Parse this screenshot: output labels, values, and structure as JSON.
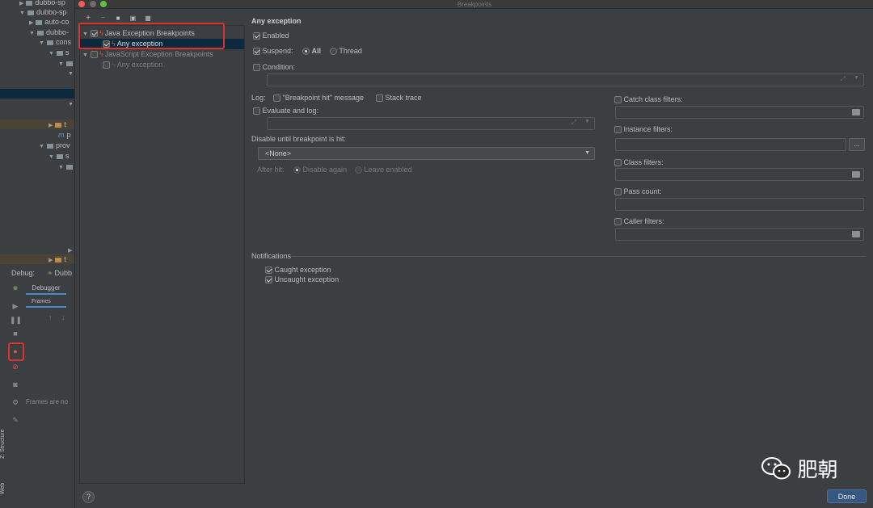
{
  "ide": {
    "tree": [
      {
        "label": "dubbo-sp"
      },
      {
        "label": "dubbo-sp"
      },
      {
        "label": "auto-co"
      },
      {
        "label": "dubbo-"
      },
      {
        "label": "cons"
      },
      {
        "label": "s"
      },
      {
        "label": "t"
      },
      {
        "label": "p"
      },
      {
        "label": "prov"
      },
      {
        "label": "s"
      },
      {
        "label": "t"
      }
    ],
    "debug_label": "Debug:",
    "debug_config": "Dubb",
    "debugger_tab": "Debugger",
    "frames_tab": "Frames",
    "frames_message": "Frames are no",
    "side_tabs": {
      "structure": "Z: Structure",
      "web": "Web"
    }
  },
  "dialog": {
    "title": "Breakpoints",
    "toolbar": [
      "+",
      "−",
      "■",
      "▣",
      "▦"
    ],
    "tree": {
      "java_group": "Java Exception Breakpoints",
      "java_any": "Any exception",
      "js_group": "JavaScript Exception Breakpoints",
      "js_any": "Any exception"
    },
    "settings": {
      "heading": "Any exception",
      "enabled": "Enabled",
      "suspend": "Suspend:",
      "suspend_all": "All",
      "suspend_thread": "Thread",
      "condition": "Condition:",
      "log": "Log:",
      "log_message": "\"Breakpoint hit\" message",
      "log_stack": "Stack trace",
      "evaluate": "Evaluate and log:",
      "disable_until": "Disable until breakpoint is hit:",
      "disable_until_value": "<None>",
      "after_hit": "After hit:",
      "disable_again": "Disable again",
      "leave_enabled": "Leave enabled",
      "catch_filters": "Catch class filters:",
      "instance_filters": "Instance filters:",
      "class_filters": "Class filters:",
      "pass_count": "Pass count:",
      "caller_filters": "Caller filters:",
      "browse_button": "...",
      "notifications": "Notifications",
      "caught": "Caught exception",
      "uncaught": "Uncaught exception"
    },
    "help_button": "?",
    "done_button": "Done"
  },
  "watermark": {
    "text": "肥朝"
  },
  "colors": {
    "bg_dark": "#2b2b2b",
    "panel": "#3c3f41",
    "selection": "#0d293e",
    "highlight_red": "#d9342b",
    "done_blue": "#365880",
    "bolt_red": "#e05151"
  }
}
